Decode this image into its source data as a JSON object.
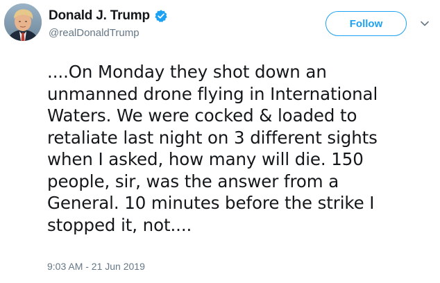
{
  "author": {
    "display_name": "Donald J. Trump",
    "handle": "@realDonaldTrump",
    "verified": true
  },
  "actions": {
    "follow_label": "Follow"
  },
  "tweet": {
    "lines": [
      "....On Monday they shot down an",
      "unmanned drone flying in International",
      "Waters. We were cocked & loaded to",
      "retaliate last night on 3 different sights",
      "when I asked, how many will die. 150",
      "people, sir, was the answer from a",
      "General. 10 minutes before the strike I",
      "stopped it, not...."
    ],
    "timestamp": "9:03 AM - 21 Jun 2019"
  },
  "colors": {
    "accent": "#1da1f2",
    "text": "#14171a",
    "muted": "#657786"
  },
  "icons": {
    "verified": "verified-badge-icon",
    "caret": "chevron-down-icon"
  }
}
